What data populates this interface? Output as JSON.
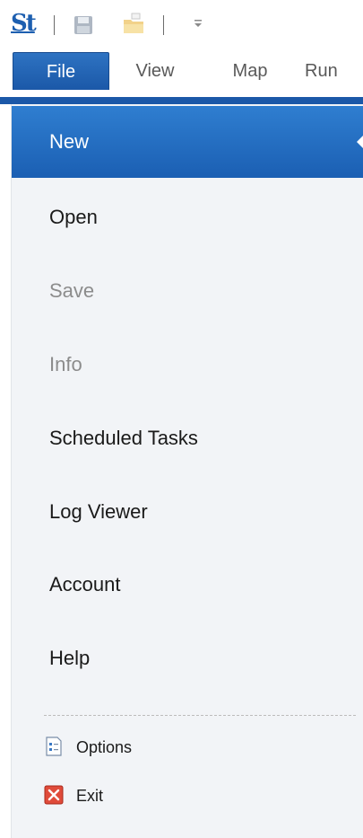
{
  "quick_access": {
    "logo_text": "St",
    "icons": [
      "save-icon",
      "open-folder-icon",
      "customize-dropdown-icon"
    ]
  },
  "ribbon": {
    "tabs": [
      {
        "label": "File",
        "active": true
      },
      {
        "label": "View",
        "active": false
      },
      {
        "label": "Map",
        "active": false
      },
      {
        "label": "Run",
        "active": false
      }
    ],
    "accent_color": "#1b58a8"
  },
  "backstage": {
    "items": [
      {
        "label": "New",
        "state": "selected"
      },
      {
        "label": "Open",
        "state": "enabled"
      },
      {
        "label": "Save",
        "state": "disabled"
      },
      {
        "label": "Info",
        "state": "disabled"
      },
      {
        "label": "Scheduled Tasks",
        "state": "enabled"
      },
      {
        "label": "Log Viewer",
        "state": "enabled"
      },
      {
        "label": "Account",
        "state": "enabled"
      },
      {
        "label": "Help",
        "state": "enabled"
      }
    ],
    "footer_items": [
      {
        "label": "Options",
        "icon": "options-document-icon"
      },
      {
        "label": "Exit",
        "icon": "exit-x-icon"
      }
    ],
    "panel_color": "#f2f4f7",
    "selected_color": "#1b5fb3"
  }
}
